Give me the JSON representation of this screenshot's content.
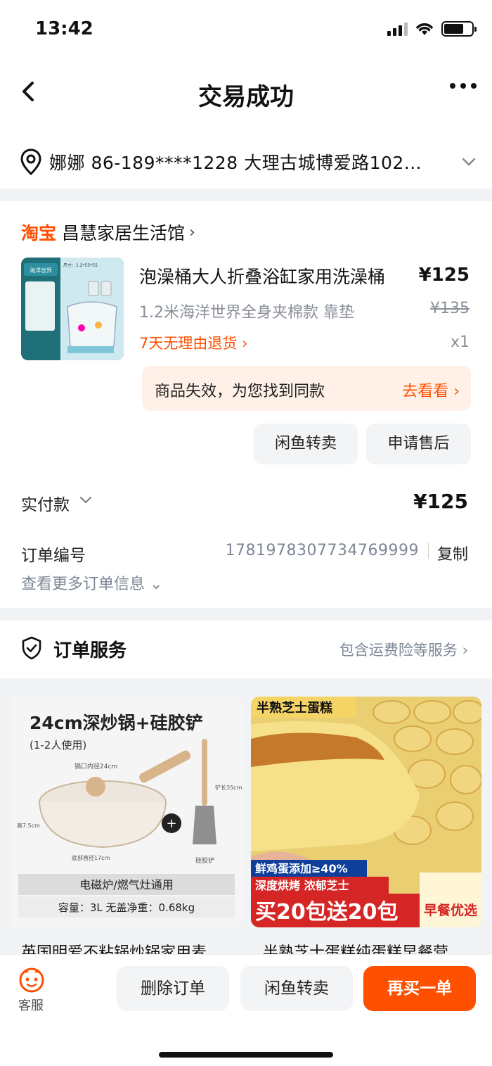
{
  "status": {
    "time": "13:42"
  },
  "nav": {
    "title": "交易成功"
  },
  "address": {
    "text": "娜娜  86-189****1228  大理古城博爱路102..."
  },
  "shop": {
    "platform": "淘宝",
    "name": "昌慧家居生活馆"
  },
  "product": {
    "name": "泡澡桶大人折叠浴缸家用洗澡桶",
    "price": "¥125",
    "spec": "1.2米海洋世界全身夹棉款 靠垫",
    "original_price": "¥135",
    "return_policy": "7天无理由退货 ›",
    "quantity": "x1",
    "img_tag": "海洋世界",
    "img_size": "尺寸：1.2*55*55"
  },
  "notice": {
    "text": "商品失效，为您找到同款",
    "link": "去看看 ›"
  },
  "actions": {
    "resell": "闲鱼转卖",
    "after_sale": "申请售后"
  },
  "payment": {
    "label": "实付款",
    "amount": "¥125"
  },
  "order": {
    "number_label": "订单编号",
    "number": "1781978307734769999",
    "copy": "复制",
    "more": "查看更多订单信息 ⌄"
  },
  "service": {
    "title": "订单服务",
    "link": "包含运费险等服务 ›"
  },
  "recommendations": [
    {
      "headline": "24cm深炒锅+硅胶铲",
      "sub": "(1-2人使用)",
      "caliber": "锅口内径24cm",
      "height": "高7.5cm",
      "bottom": "底部直径17cm",
      "spatula_len": "铲长35cm",
      "spatula": "硅胶铲",
      "band1": "电磁炉/燃气灶通用",
      "band2": "容量：3L    无盖净重：0.68kg",
      "title": "英国明爱不粘锅炒锅家用麦"
    },
    {
      "headline": "半熟芝士蛋糕",
      "line1": "鲜鸡蛋添加≥40%",
      "line2": "深度烘烤 浓郁芝士",
      "line3": "买20包送20包",
      "badge": "早餐优选",
      "title": "半熟芝士蛋糕纯蛋糕早餐营"
    }
  ],
  "bottom": {
    "cs_label": "客服",
    "delete": "删除订单",
    "resell": "闲鱼转卖",
    "rebuy": "再买一单"
  },
  "colors": {
    "accent": "#ff5000",
    "notice_bg": "#fff1e8",
    "muted": "#7d8796"
  }
}
